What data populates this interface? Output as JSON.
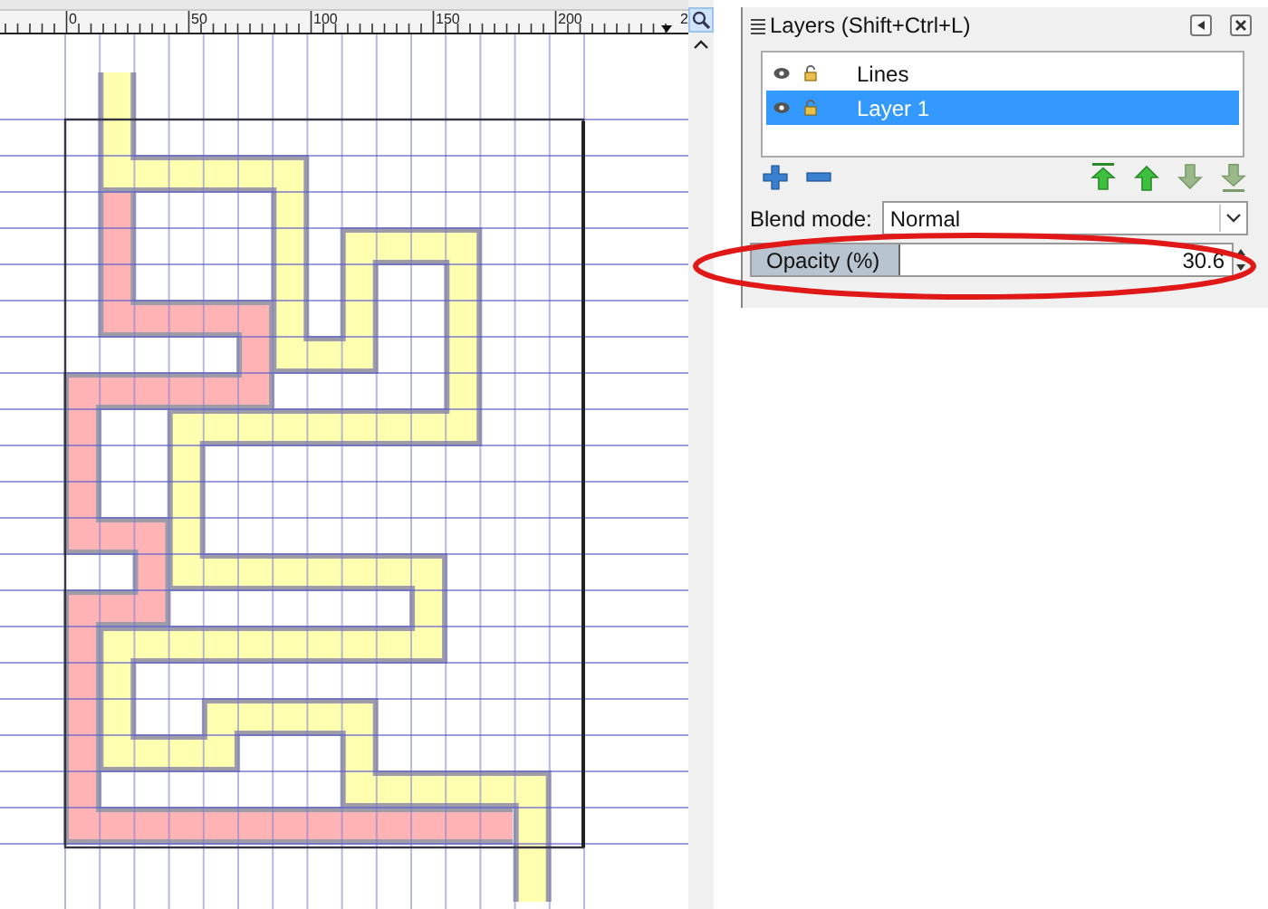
{
  "ruler": {
    "labels": [
      "0",
      "50",
      "100",
      "150",
      "200",
      "2"
    ]
  },
  "layers_panel": {
    "title": "Layers (Shift+Ctrl+L)",
    "layers": [
      {
        "name": "Lines",
        "selected": false
      },
      {
        "name": "Layer 1",
        "selected": true
      }
    ],
    "move_buttons": [
      {
        "kind": "top",
        "disabled": false
      },
      {
        "kind": "up",
        "disabled": false
      },
      {
        "kind": "down",
        "disabled": true
      },
      {
        "kind": "bottom",
        "disabled": true
      }
    ],
    "blend_mode": {
      "label": "Blend mode:",
      "value": "Normal"
    },
    "opacity": {
      "label": "Opacity (%)",
      "value": "30.6",
      "level": 0.306
    }
  }
}
